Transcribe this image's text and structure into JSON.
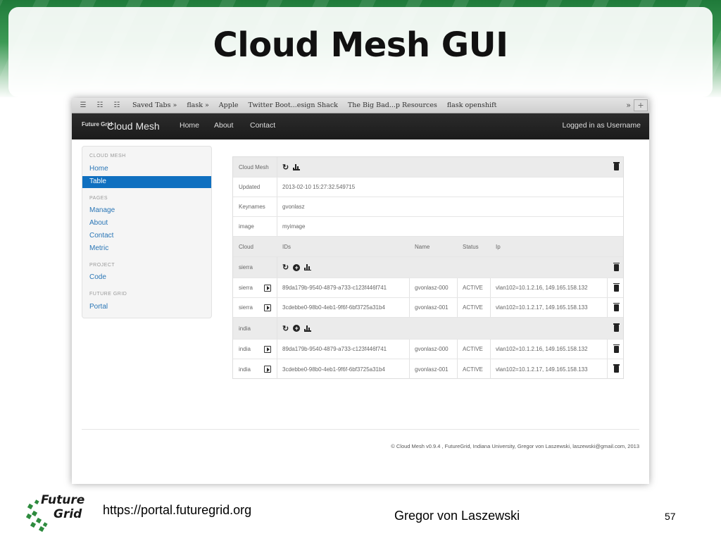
{
  "slide": {
    "title": "Cloud Mesh GUI",
    "url": "https://portal.futuregrid.org",
    "author": "Gregor von Laszewski",
    "page_number": "57",
    "logo_line1": "Future",
    "logo_line2": "Grid"
  },
  "browser": {
    "bookmarks": [
      "Saved Tabs »",
      "flask »",
      "Apple",
      "Twitter Boot...esign Shack",
      "The Big Bad...p Resources",
      "flask openshift"
    ],
    "overflow": "»",
    "new_tab": "+"
  },
  "app": {
    "brand": "Cloud Mesh",
    "logo_text": "Future Grid",
    "nav": [
      "Home",
      "About",
      "Contact"
    ],
    "user": "Logged in as Username"
  },
  "sidebar": {
    "sections": [
      {
        "header": "CLOUD MESH",
        "items": [
          "Home",
          "Table"
        ]
      },
      {
        "header": "PAGES",
        "items": [
          "Manage",
          "About",
          "Contact",
          "Metric"
        ]
      },
      {
        "header": "PROJECT",
        "items": [
          "Code"
        ]
      },
      {
        "header": "FUTURE GRID",
        "items": [
          "Portal"
        ]
      }
    ],
    "active": "Table"
  },
  "table": {
    "title": "Cloud Mesh",
    "info": [
      {
        "label": "Updated",
        "value": "2013-02-10 15:27:32.549715"
      },
      {
        "label": "Keynames",
        "value": "gvonlasz"
      },
      {
        "label": "image",
        "value": "myimage"
      }
    ],
    "columns": [
      "Cloud",
      "IDs",
      "Name",
      "Status",
      "Ip"
    ],
    "groups": [
      {
        "name": "sierra",
        "vms": [
          {
            "cloud": "sierra",
            "id": "89da179b-9540-4879-a733-c123f446f741",
            "name": "gvonlasz-000",
            "status": "ACTIVE",
            "ip": "vlan102=10.1.2.16, 149.165.158.132"
          },
          {
            "cloud": "sierra",
            "id": "3cdebbe0-98b0-4eb1-9f6f-6bf3725a31b4",
            "name": "gvonlasz-001",
            "status": "ACTIVE",
            "ip": "vlan102=10.1.2.17, 149.165.158.133"
          }
        ]
      },
      {
        "name": "india",
        "vms": [
          {
            "cloud": "india",
            "id": "89da179b-9540-4879-a733-c123f446f741",
            "name": "gvonlasz-000",
            "status": "ACTIVE",
            "ip": "vlan102=10.1.2.16, 149.165.158.132"
          },
          {
            "cloud": "india",
            "id": "3cdebbe0-98b0-4eb1-9f6f-6bf3725a31b4",
            "name": "gvonlasz-001",
            "status": "ACTIVE",
            "ip": "vlan102=10.1.2.17, 149.165.158.133"
          }
        ]
      }
    ]
  },
  "footer": {
    "text": "© Cloud Mesh v0.9.4 , FutureGrid, Indiana University, Gregor von Laszewski, laszewski@gmail.com, 2013"
  },
  "icons": {
    "refresh": "refresh-icon",
    "add": "add-icon",
    "chart": "bar-chart-icon",
    "delete": "trash-icon",
    "console": "play-icon"
  }
}
